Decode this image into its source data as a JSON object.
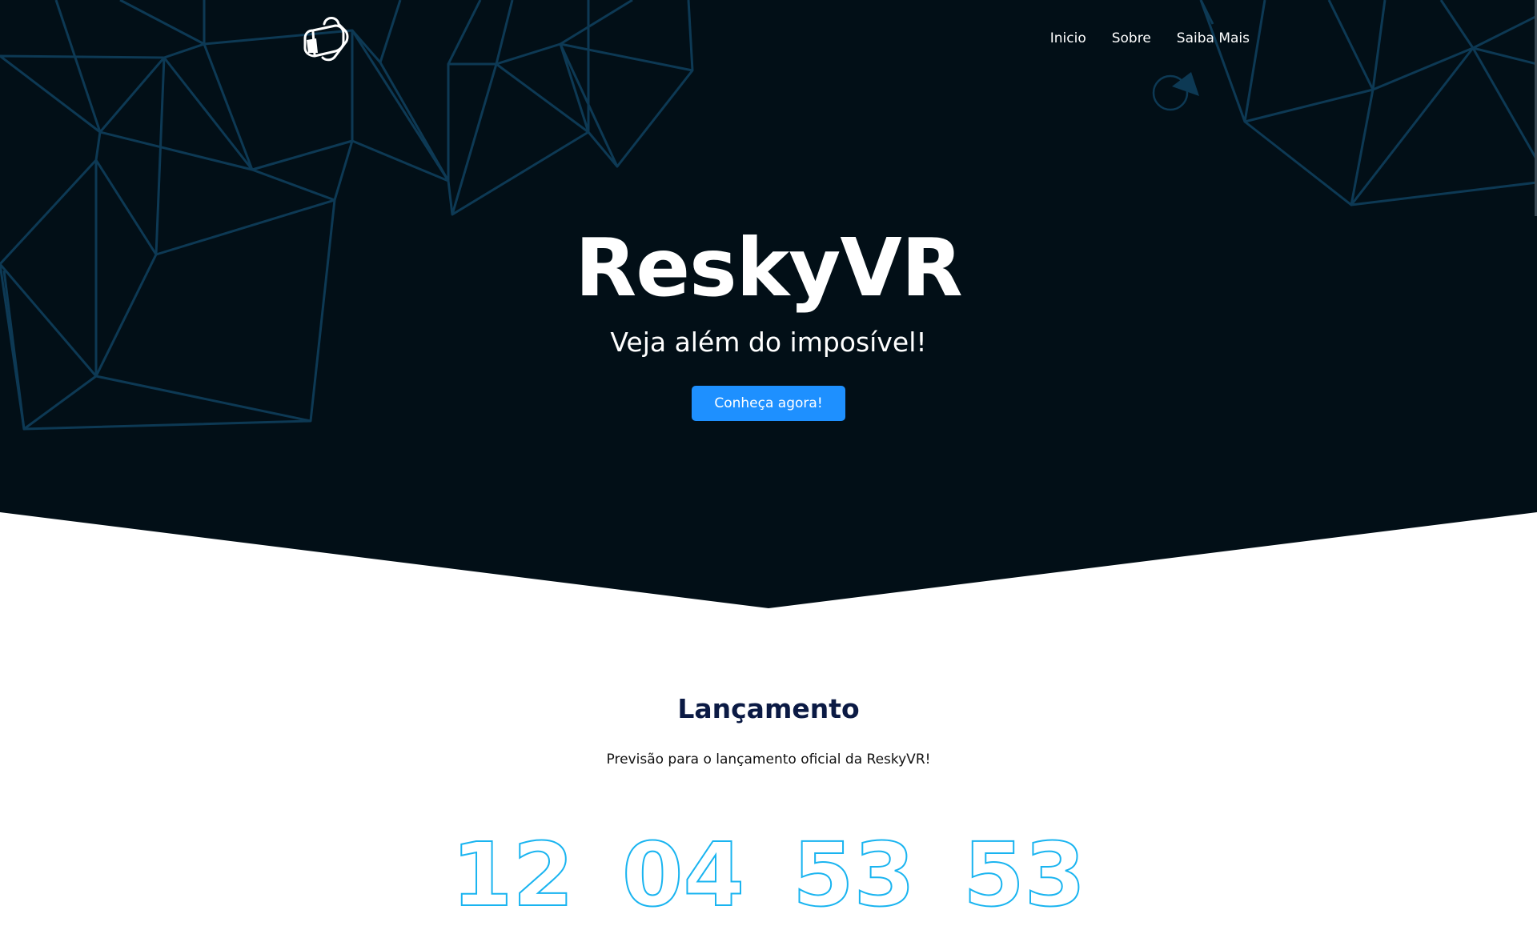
{
  "brand": {
    "logo_icon": "vr-headset-icon"
  },
  "nav": {
    "items": [
      {
        "label": "Inicio"
      },
      {
        "label": "Sobre"
      },
      {
        "label": "Saiba Mais"
      }
    ]
  },
  "hero": {
    "title": "ReskyVR",
    "subtitle": "Veja além do imposível!",
    "cta_label": "Conheça agora!"
  },
  "launch": {
    "title": "Lançamento",
    "description": "Previsão para o lançamento oficial da ReskyVR!",
    "countdown": [
      "12",
      "04",
      "53",
      "53"
    ]
  },
  "colors": {
    "hero_bg": "#020f17",
    "lines": "#0d3954",
    "accent": "#1e90ff",
    "heading": "#0b1a44",
    "countdown_stroke": "#19b4f0"
  }
}
